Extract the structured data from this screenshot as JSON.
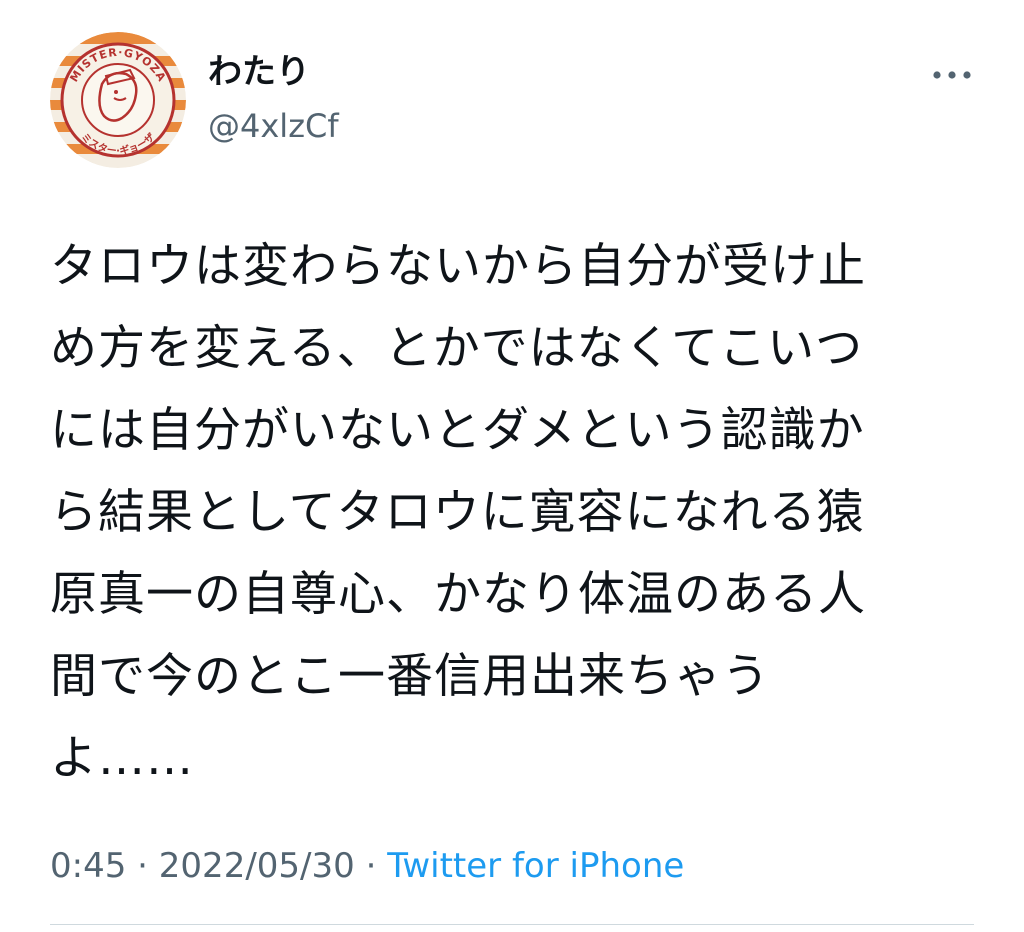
{
  "user": {
    "display_name": "わたり",
    "handle": "@4xlzCf",
    "avatar_text": {
      "top": "MISTER·GYOZA",
      "bottom": "ミスター·ギョーザ"
    }
  },
  "more_icon": "more-horizontal-icon",
  "tweet": {
    "lines": [
      "タロウは変わらないから自分が受け止",
      "め方を変える、とかではなくてこいつ",
      "には自分がいないとダメという認識か",
      "ら結果としてタロウに寛容になれる猿",
      "原真一の自尊心、かなり体温のある人",
      "間で今のとこ一番信用出来ちゃう",
      "よ……"
    ]
  },
  "meta": {
    "time": "0:45",
    "separator": " · ",
    "date": "2022/05/30",
    "source": "Twitter for iPhone"
  },
  "colors": {
    "text_primary": "#0f1419",
    "text_secondary": "#536471",
    "link": "#1d9bf0",
    "divider": "#cfd9de"
  }
}
